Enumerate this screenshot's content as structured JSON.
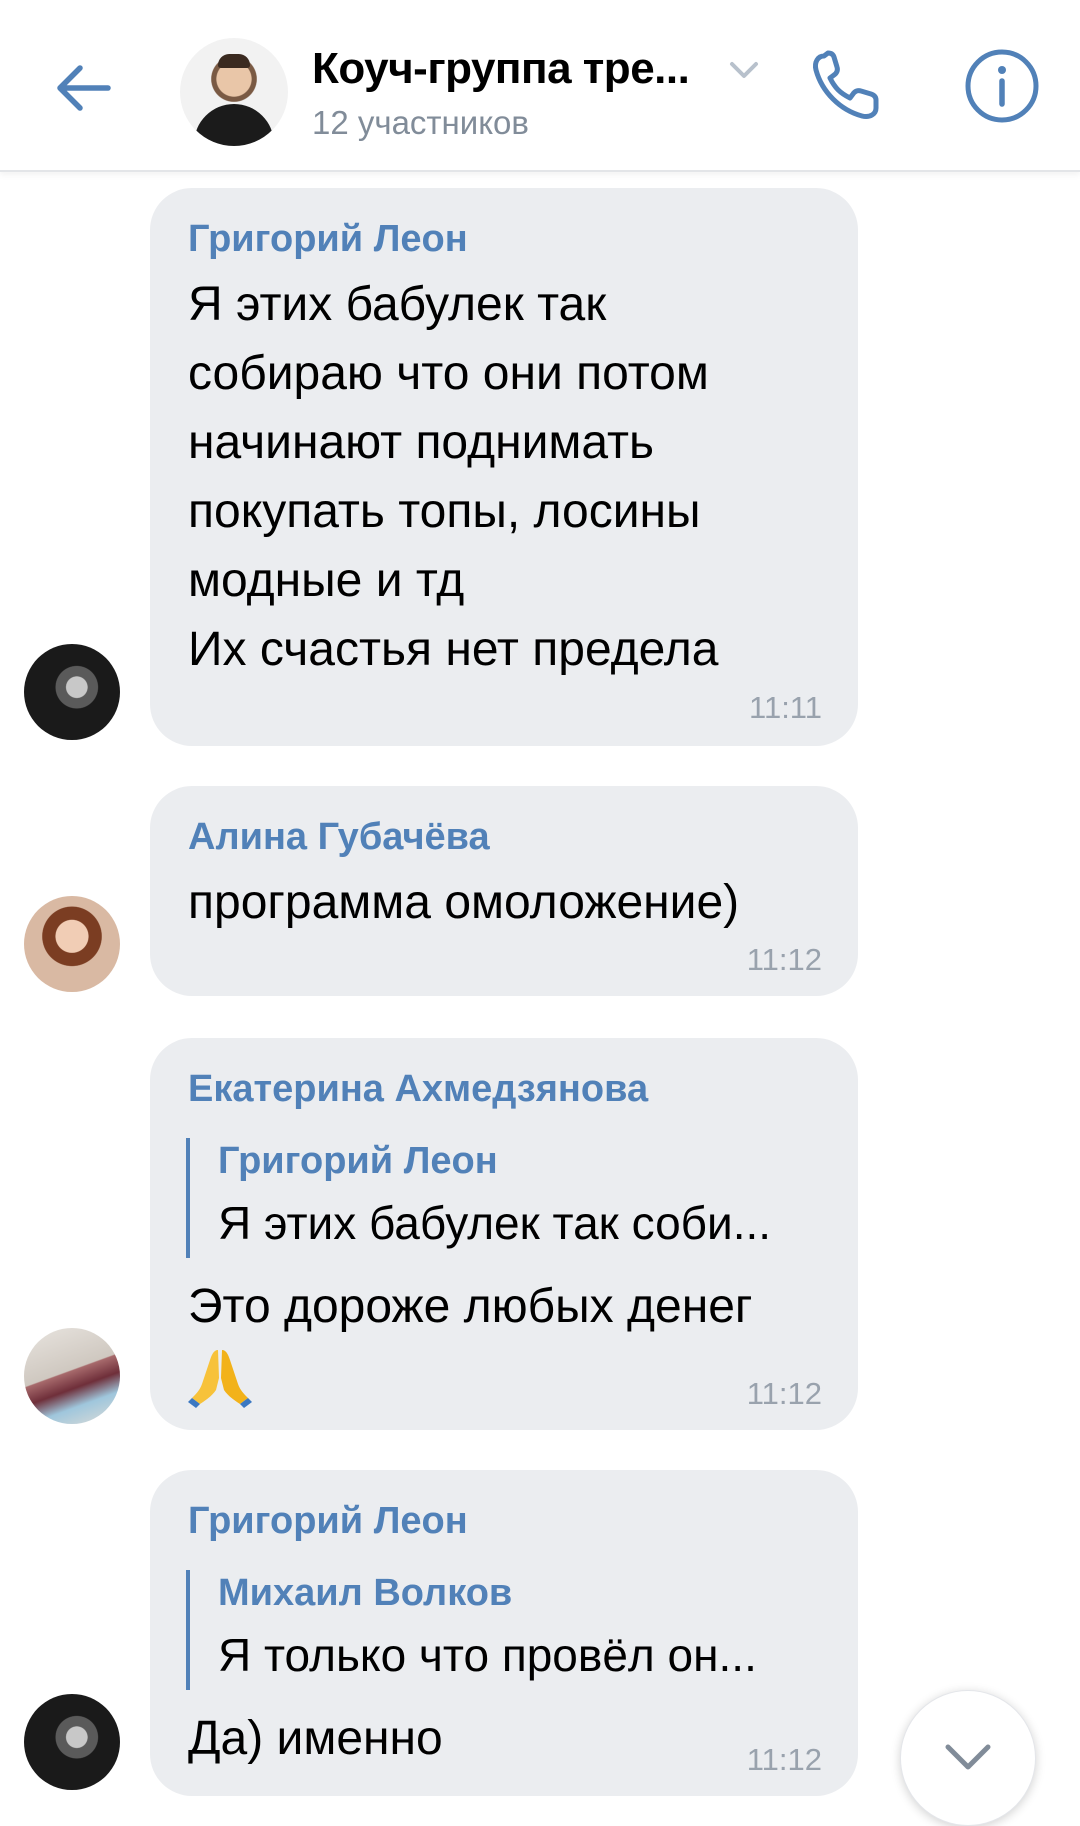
{
  "header": {
    "title": "Коуч-группа тре...",
    "subtitle": "12 участников",
    "accent_color": "#5181b8",
    "icons": [
      "back-arrow-icon",
      "chevron-down-icon",
      "phone-icon",
      "info-icon"
    ]
  },
  "messages": [
    {
      "sender": "Григорий Леон",
      "text": "Я этих бабулек так\nсобираю что они потом\nначинают поднимать\nпокупать топы, лосины\nмодные и тд\nИх счастья нет предела",
      "time": "11:11"
    },
    {
      "sender": "Алина Губачёва",
      "text": "программа омоложение)",
      "time": "11:12"
    },
    {
      "sender": "Екатерина Ахмедзянова",
      "reply_sender": "Григорий Леон",
      "reply_text": "Я этих бабулек так соби...",
      "text": "Это дороже любых денег",
      "emoji": "🙏",
      "time": "11:12"
    },
    {
      "sender": "Григорий Леон",
      "reply_sender": "Михаил Волков",
      "reply_text": "Я только что провёл он...",
      "text": "Да) именно",
      "time": "11:12"
    }
  ],
  "scroll_button": {
    "icon": "chevron-down-icon"
  }
}
